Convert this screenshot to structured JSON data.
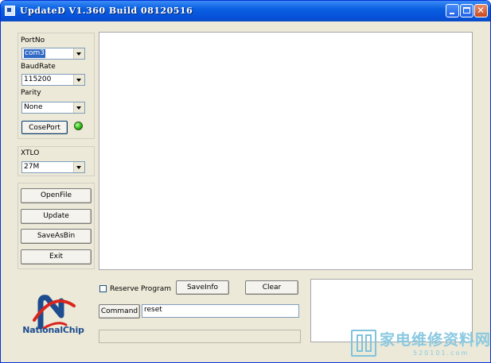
{
  "window": {
    "title": "UpdateD V1.360 Build 08120516",
    "controls": {
      "minimize": "minimize-icon",
      "maximize": "maximize-icon",
      "close": "close-icon"
    }
  },
  "port_settings": {
    "portno_label": "PortNo",
    "portno_value": "com3",
    "baudrate_label": "BaudRate",
    "baudrate_value": "115200",
    "parity_label": "Parity",
    "parity_value": "None",
    "close_port_label": "CosePort",
    "status_led_color": "#1fb30a"
  },
  "xtlo": {
    "label": "XTLO",
    "value": "27M"
  },
  "actions": {
    "open_file": "OpenFile",
    "update": "Update",
    "save_as_bin": "SaveAsBin",
    "exit": "Exit"
  },
  "bottom": {
    "reserve_program_label": "Reserve Program",
    "reserve_program_checked": false,
    "save_info_label": "SaveInfo",
    "clear_label": "Clear",
    "command_label": "Command",
    "command_value": "reset",
    "progress_fraction": 0.0
  },
  "logo": {
    "text": "NationalChip",
    "color": "#1d4d8f",
    "accent": "#d9251d"
  },
  "watermark": {
    "text": "家电维修资料网",
    "sub": "520101.com",
    "color": "#8bc9e0"
  }
}
